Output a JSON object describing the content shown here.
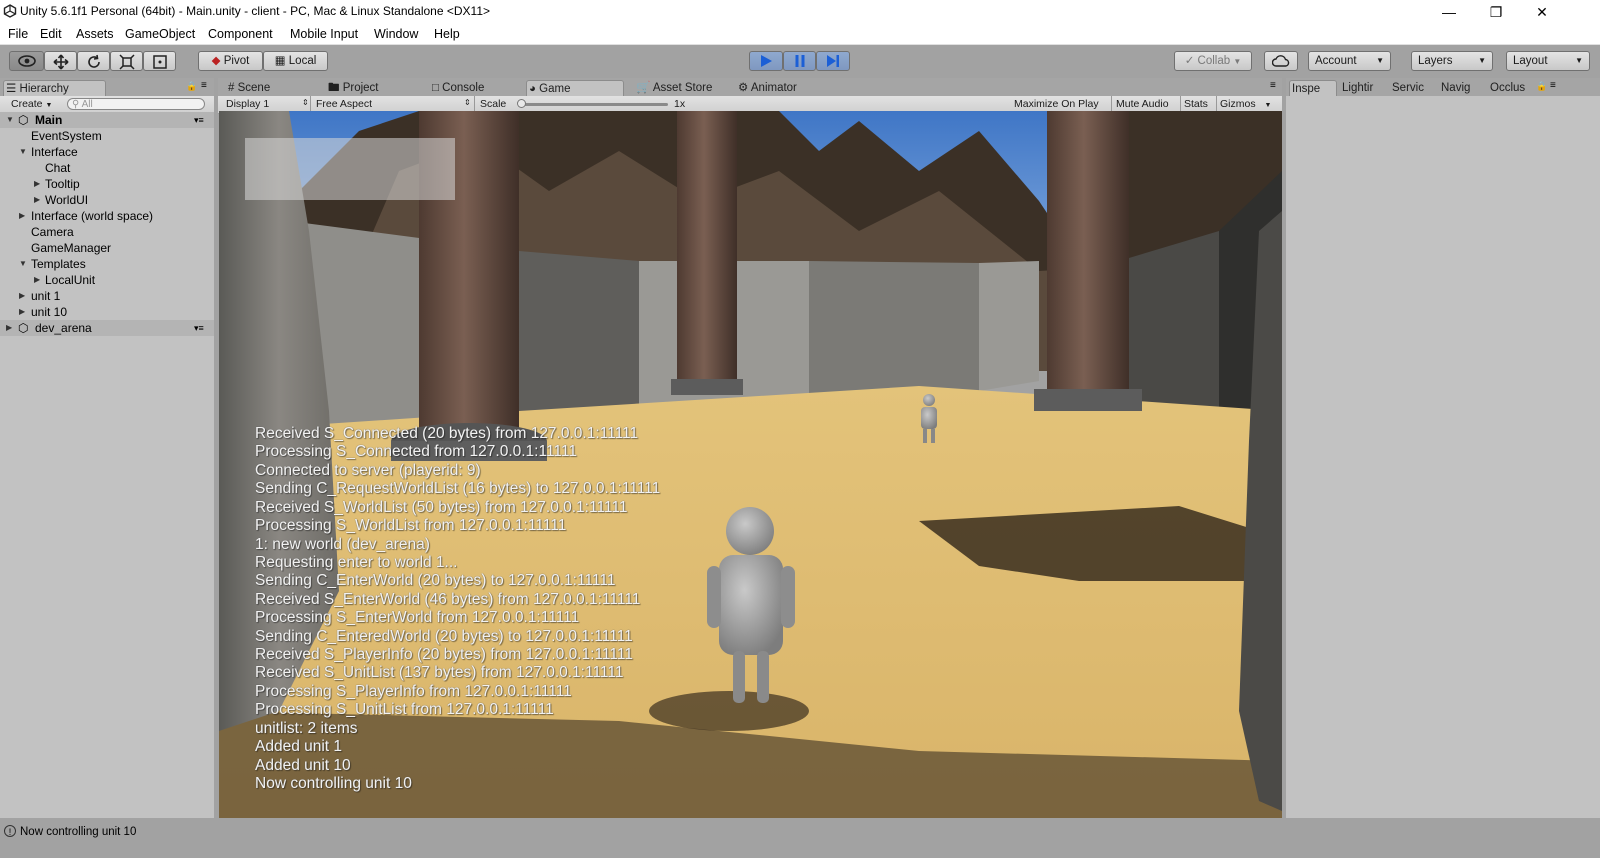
{
  "window": {
    "title": "Unity 5.6.1f1 Personal (64bit) - Main.unity - client - PC, Mac & Linux Standalone <DX11>"
  },
  "menu": [
    "File",
    "Edit",
    "Assets",
    "GameObject",
    "Component",
    "Mobile Input",
    "Window",
    "Help"
  ],
  "toolbar": {
    "pivot_label": "Pivot",
    "local_label": "Local",
    "collab_label": "Collab",
    "account_label": "Account",
    "layers_label": "Layers",
    "layout_label": "Layout"
  },
  "hierarchy": {
    "tab_label": "Hierarchy",
    "create_label": "Create",
    "search_placeholder": "All",
    "items": [
      {
        "label": "Main",
        "type": "scene"
      },
      {
        "label": "EventSystem"
      },
      {
        "label": "Interface"
      },
      {
        "label": "Chat"
      },
      {
        "label": "Tooltip"
      },
      {
        "label": "WorldUI"
      },
      {
        "label": "Interface (world space)"
      },
      {
        "label": "Camera"
      },
      {
        "label": "GameManager"
      },
      {
        "label": "Templates"
      },
      {
        "label": "LocalUnit"
      },
      {
        "label": "unit 1"
      },
      {
        "label": "unit 10"
      },
      {
        "label": "dev_arena",
        "type": "scene"
      }
    ]
  },
  "center_tabs": [
    "Scene",
    "Project",
    "Console",
    "Game",
    "Asset Store",
    "Animator"
  ],
  "game_bar": {
    "display": "Display 1",
    "aspect": "Free Aspect",
    "scale_label": "Scale",
    "scale_value": "1x",
    "scale_fraction": 0.0,
    "maximize": "Maximize On Play",
    "mute": "Mute Audio",
    "stats": "Stats",
    "gizmos": "Gizmos"
  },
  "game_log": [
    "Received S_Connected (20 bytes) from 127.0.0.1:11111",
    "Processing S_Connected from 127.0.0.1:11111",
    "Connected to server (playerid: 9)",
    "Sending C_RequestWorldList (16 bytes) to 127.0.0.1:11111",
    "Received S_WorldList (50 bytes) from 127.0.0.1:11111",
    "Processing S_WorldList from 127.0.0.1:11111",
    "1: new world (dev_arena)",
    "Requesting enter to world 1...",
    "Sending C_EnterWorld (20 bytes) to 127.0.0.1:11111",
    "Received S_EnterWorld (46 bytes) from 127.0.0.1:11111",
    "Processing S_EnterWorld from 127.0.0.1:11111",
    "Sending C_EnteredWorld (20 bytes) to 127.0.0.1:11111",
    "Received S_PlayerInfo (20 bytes) from 127.0.0.1:11111",
    "Received S_UnitList (137 bytes) from 127.0.0.1:11111",
    "Processing S_PlayerInfo from 127.0.0.1:11111",
    "Processing S_UnitList from 127.0.0.1:11111",
    "unitlist: 2 items",
    "Added unit 1",
    "Added unit 10",
    "Now controlling unit 10"
  ],
  "inspector_tabs": [
    "Inspe",
    "Lightir",
    "Servic",
    "Navig",
    "Occlus"
  ],
  "status": {
    "text": "Now controlling unit 10"
  }
}
